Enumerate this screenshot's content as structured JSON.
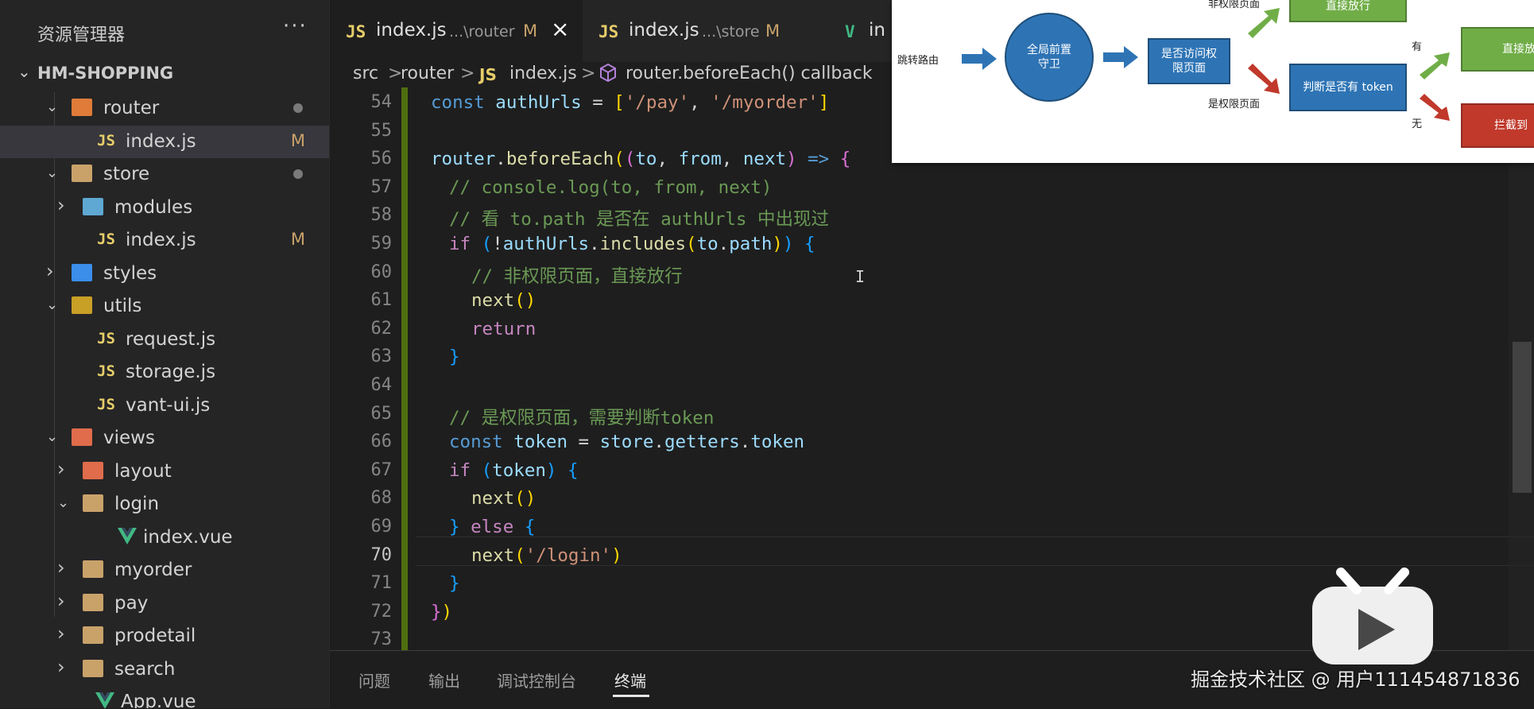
{
  "sidebar": {
    "title": "资源管理器",
    "more": "···",
    "project": "HM-SHOPPING",
    "items": [
      {
        "label": "router",
        "type": "folder",
        "expanded": true,
        "dot": true
      },
      {
        "label": "index.js",
        "type": "js",
        "badge": "M",
        "selected": true
      },
      {
        "label": "store",
        "type": "folder",
        "expanded": true,
        "dot": true
      },
      {
        "label": "modules",
        "type": "folder",
        "expanded": false
      },
      {
        "label": "index.js",
        "type": "js",
        "badge": "M"
      },
      {
        "label": "styles",
        "type": "folder",
        "expanded": false
      },
      {
        "label": "utils",
        "type": "folder",
        "expanded": true
      },
      {
        "label": "request.js",
        "type": "js"
      },
      {
        "label": "storage.js",
        "type": "js"
      },
      {
        "label": "vant-ui.js",
        "type": "js"
      },
      {
        "label": "views",
        "type": "folder",
        "expanded": true
      },
      {
        "label": "layout",
        "type": "folder",
        "expanded": false
      },
      {
        "label": "login",
        "type": "folder",
        "expanded": true
      },
      {
        "label": "index.vue",
        "type": "vue"
      },
      {
        "label": "myorder",
        "type": "folder",
        "expanded": false
      },
      {
        "label": "pay",
        "type": "folder",
        "expanded": false
      },
      {
        "label": "prodetail",
        "type": "folder",
        "expanded": false
      },
      {
        "label": "search",
        "type": "folder",
        "expanded": false
      },
      {
        "label": "App.vue",
        "type": "vue"
      }
    ]
  },
  "tabs": [
    {
      "icon": "JS",
      "name": "index.js",
      "path": "...\\router",
      "badge": "M",
      "close": "×"
    },
    {
      "icon": "JS",
      "name": "index.js",
      "path": "...\\store",
      "badge": "M"
    },
    {
      "icon": "V",
      "name": "in"
    }
  ],
  "breadcrumb": {
    "src": "src",
    "router": "router",
    "js": "JS",
    "file": "index.js",
    "symbol": "router.beforeEach() callback",
    "sep": ">"
  },
  "code": {
    "line_numbers": [
      "54",
      "55",
      "56",
      "57",
      "58",
      "59",
      "60",
      "61",
      "62",
      "63",
      "64",
      "65",
      "66",
      "67",
      "68",
      "69",
      "70",
      "71",
      "72",
      "73"
    ],
    "current_line": "70"
  },
  "panel": {
    "tabs": [
      "问题",
      "输出",
      "调试控制台",
      "终端"
    ],
    "active": "终端"
  },
  "flow": {
    "jump": "跳转路由",
    "guard": "全局前置守卫",
    "check": "是否访问权限页面",
    "not_auth": "非权限页面",
    "is_auth": "是权限页面",
    "pass_top": "直接放行",
    "token_check": "判断是否有 token",
    "has": "有",
    "none": "无",
    "pass": "直接放",
    "intercept": "拦截到"
  },
  "watermark": "掘金技术社区 @ 用户111454871836"
}
